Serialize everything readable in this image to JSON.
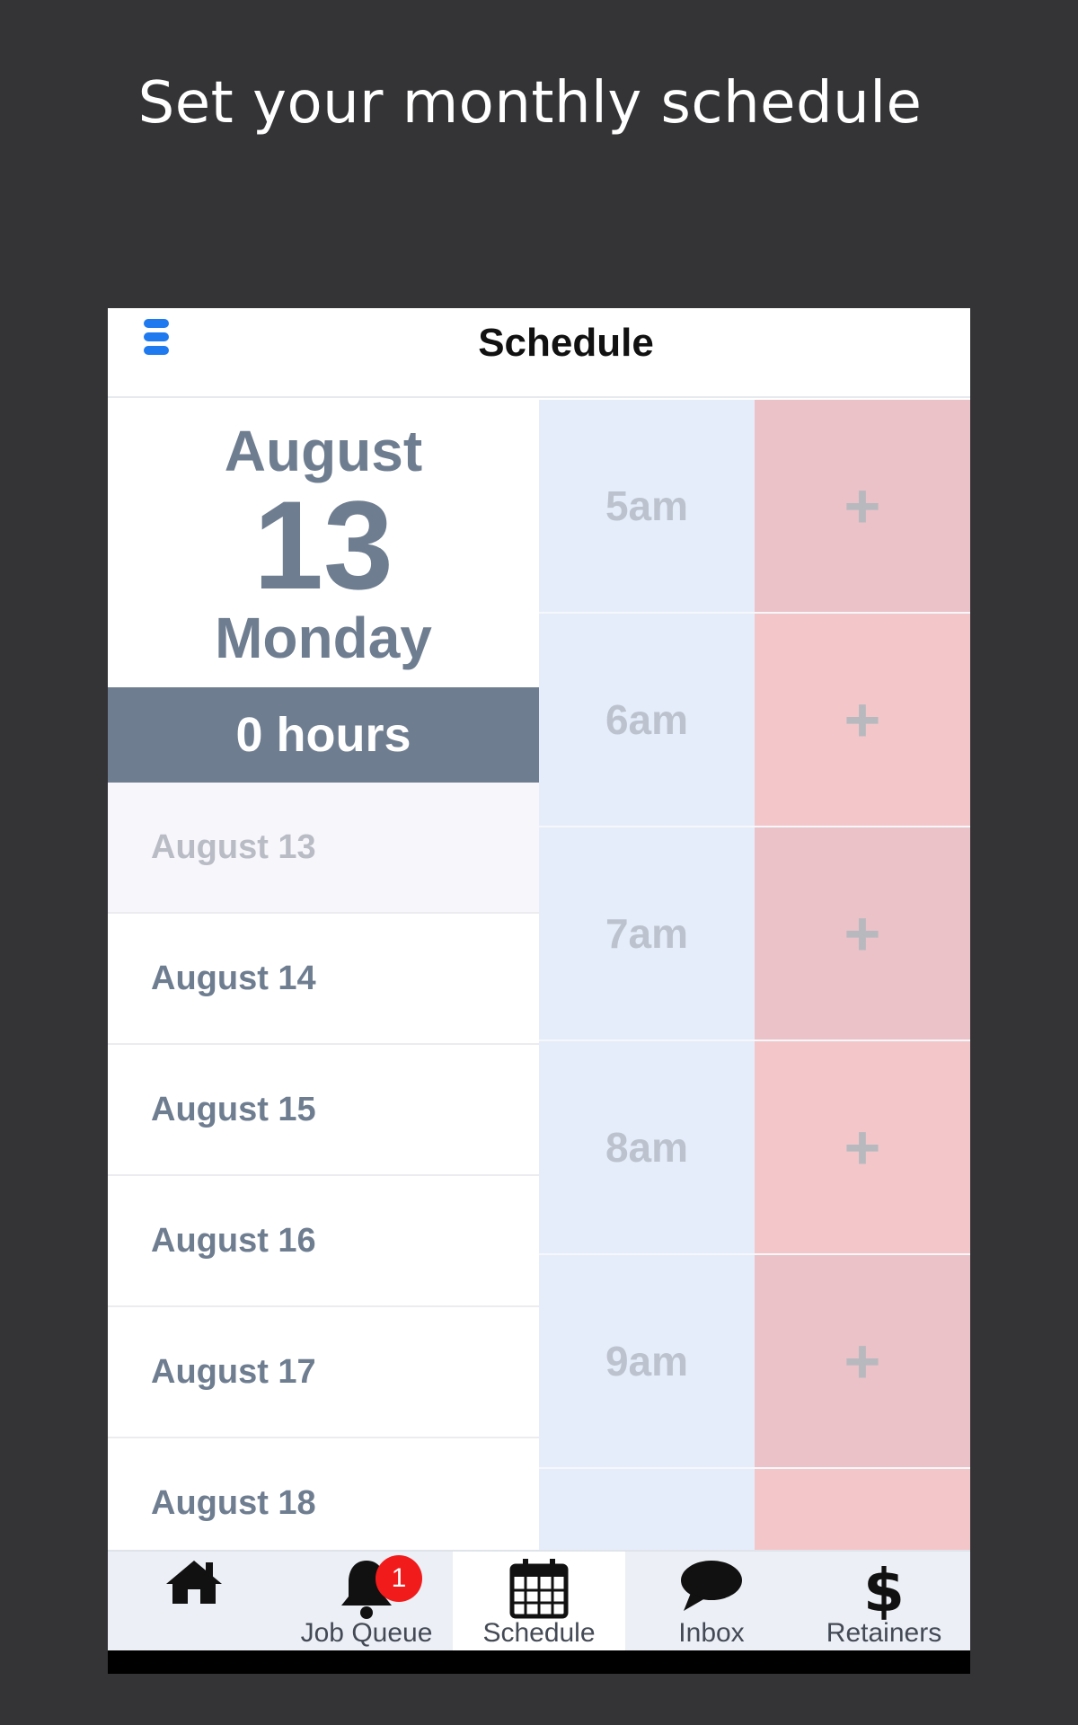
{
  "headline": "Set your monthly schedule",
  "navbar": {
    "title": "Schedule",
    "menu_icon": "hamburger-menu-icon"
  },
  "selected_date": {
    "month": "August",
    "day": "13",
    "weekday": "Monday",
    "hours": "0 hours"
  },
  "date_list": [
    "August 13",
    "August 14",
    "August 15",
    "August 16",
    "August 17",
    "August 18"
  ],
  "time_slots": [
    "5am",
    "6am",
    "7am",
    "8am",
    "9am",
    ""
  ],
  "add_symbol": "+",
  "tabs": [
    {
      "label": "",
      "icon": "home-icon"
    },
    {
      "label": "Job Queue",
      "icon": "bell-icon",
      "badge": "1"
    },
    {
      "label": "Schedule",
      "icon": "calendar-icon",
      "active": true
    },
    {
      "label": "Inbox",
      "icon": "chat-bubble-icon"
    },
    {
      "label": "Retainers",
      "icon": "dollar-icon"
    }
  ],
  "colors": {
    "accent_blue": "#1f7aef",
    "slate": "#6e7d90",
    "time_column_bg": "#e6edfa",
    "add_column_bg": "#f3c7ca",
    "badge_red": "#f21b1b"
  }
}
